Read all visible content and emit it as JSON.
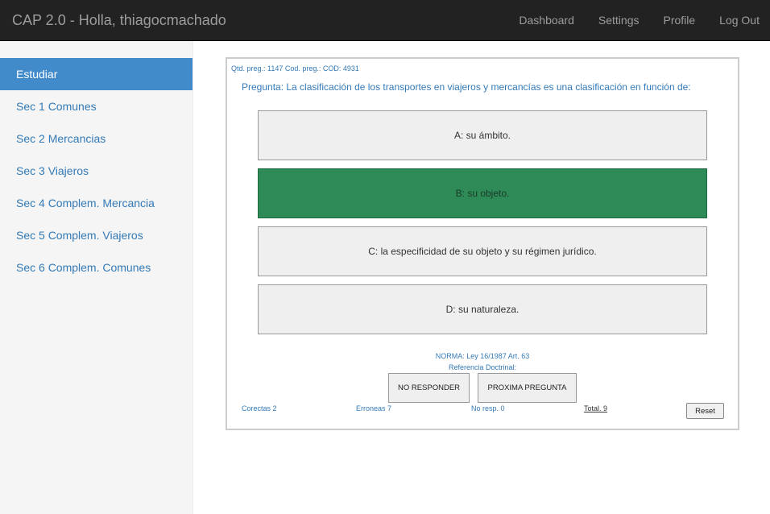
{
  "navbar": {
    "brand": "CAP 2.0 - Holla, thiagocmachado",
    "links": [
      "Dashboard",
      "Settings",
      "Profile",
      "Log Out"
    ]
  },
  "sidebar": {
    "items": [
      {
        "label": "Estudiar",
        "active": true
      },
      {
        "label": "Sec 1 Comunes"
      },
      {
        "label": "Sec 2 Mercancias"
      },
      {
        "label": "Sec 3 Viajeros"
      },
      {
        "label": "Sec 4 Complem. Mercancia"
      },
      {
        "label": "Sec 5 Complem. Viajeros"
      },
      {
        "label": "Sec 6 Complem. Comunes"
      }
    ]
  },
  "quiz": {
    "meta": "Qtd. preg.:  1147 Cod. preg.:  COD: 4931",
    "question": "Pregunta: La clasificación de los transportes en viajeros y mercancías es una clasificación en función de:",
    "answers": [
      {
        "label": "A: su ámbito."
      },
      {
        "label": "B: su objeto.",
        "correct": true
      },
      {
        "label": "C: la especificidad de su objeto y su régimen jurídico."
      },
      {
        "label": "D: su naturaleza."
      }
    ],
    "norma": "NORMA: Ley 16/1987 Art. 63",
    "referencia": "Referencia Doctrinal:",
    "no_responder_label": "NO RESPONDER",
    "proxima_label": "PROXIMA PREGUNTA",
    "stats": {
      "correctas": "Corectas 2",
      "erroneas": "Erroneas 7",
      "no_resp": "No resp. 0",
      "total": "Total. 9"
    },
    "reset_label": "Reset"
  },
  "colors": {
    "navbar_bg": "#222222",
    "active_item_bg": "#428bca",
    "correct_answer_bg": "#2e8b57",
    "link_blue": "#337ab7"
  }
}
